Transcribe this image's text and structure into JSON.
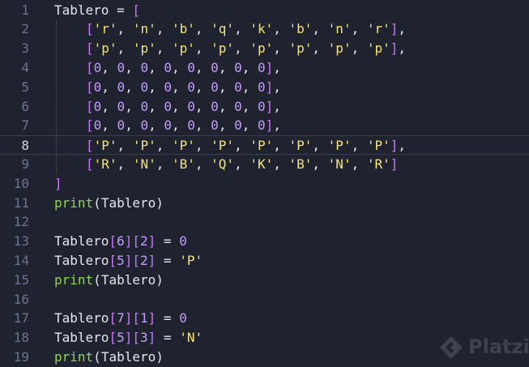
{
  "editor": {
    "colors": {
      "background": "#1f2330",
      "line_number": "#6b7393",
      "identifier": "#e6e6ea",
      "bracket": "#c678f7",
      "string": "#f5e37a",
      "number": "#c39df9",
      "builtin_call": "#8ed650"
    },
    "current_line": 8,
    "lines": [
      {
        "num": "1",
        "tokens": [
          [
            "ident",
            "Tablero"
          ],
          [
            "op",
            " = "
          ],
          [
            "brack",
            "["
          ]
        ]
      },
      {
        "num": "2",
        "indent": true,
        "tokens": [
          [
            "brack",
            "["
          ],
          [
            "str",
            "'r'"
          ],
          [
            "op",
            ", "
          ],
          [
            "str",
            "'n'"
          ],
          [
            "op",
            ", "
          ],
          [
            "str",
            "'b'"
          ],
          [
            "op",
            ", "
          ],
          [
            "str",
            "'q'"
          ],
          [
            "op",
            ", "
          ],
          [
            "str",
            "'k'"
          ],
          [
            "op",
            ", "
          ],
          [
            "str",
            "'b'"
          ],
          [
            "op",
            ", "
          ],
          [
            "str",
            "'n'"
          ],
          [
            "op",
            ", "
          ],
          [
            "str",
            "'r'"
          ],
          [
            "brack",
            "]"
          ],
          [
            "op",
            ","
          ]
        ]
      },
      {
        "num": "3",
        "indent": true,
        "tokens": [
          [
            "brack",
            "["
          ],
          [
            "str",
            "'p'"
          ],
          [
            "op",
            ", "
          ],
          [
            "str",
            "'p'"
          ],
          [
            "op",
            ", "
          ],
          [
            "str",
            "'p'"
          ],
          [
            "op",
            ", "
          ],
          [
            "str",
            "'p'"
          ],
          [
            "op",
            ", "
          ],
          [
            "str",
            "'p'"
          ],
          [
            "op",
            ", "
          ],
          [
            "str",
            "'p'"
          ],
          [
            "op",
            ", "
          ],
          [
            "str",
            "'p'"
          ],
          [
            "op",
            ", "
          ],
          [
            "str",
            "'p'"
          ],
          [
            "brack",
            "]"
          ],
          [
            "op",
            ","
          ]
        ]
      },
      {
        "num": "4",
        "indent": true,
        "tokens": [
          [
            "brack",
            "["
          ],
          [
            "num",
            "0"
          ],
          [
            "op",
            ", "
          ],
          [
            "num",
            "0"
          ],
          [
            "op",
            ", "
          ],
          [
            "num",
            "0"
          ],
          [
            "op",
            ", "
          ],
          [
            "num",
            "0"
          ],
          [
            "op",
            ", "
          ],
          [
            "num",
            "0"
          ],
          [
            "op",
            ", "
          ],
          [
            "num",
            "0"
          ],
          [
            "op",
            ", "
          ],
          [
            "num",
            "0"
          ],
          [
            "op",
            ", "
          ],
          [
            "num",
            "0"
          ],
          [
            "brack",
            "]"
          ],
          [
            "op",
            ","
          ]
        ]
      },
      {
        "num": "5",
        "indent": true,
        "tokens": [
          [
            "brack",
            "["
          ],
          [
            "num",
            "0"
          ],
          [
            "op",
            ", "
          ],
          [
            "num",
            "0"
          ],
          [
            "op",
            ", "
          ],
          [
            "num",
            "0"
          ],
          [
            "op",
            ", "
          ],
          [
            "num",
            "0"
          ],
          [
            "op",
            ", "
          ],
          [
            "num",
            "0"
          ],
          [
            "op",
            ", "
          ],
          [
            "num",
            "0"
          ],
          [
            "op",
            ", "
          ],
          [
            "num",
            "0"
          ],
          [
            "op",
            ", "
          ],
          [
            "num",
            "0"
          ],
          [
            "brack",
            "]"
          ],
          [
            "op",
            ","
          ]
        ]
      },
      {
        "num": "6",
        "indent": true,
        "tokens": [
          [
            "brack",
            "["
          ],
          [
            "num",
            "0"
          ],
          [
            "op",
            ", "
          ],
          [
            "num",
            "0"
          ],
          [
            "op",
            ", "
          ],
          [
            "num",
            "0"
          ],
          [
            "op",
            ", "
          ],
          [
            "num",
            "0"
          ],
          [
            "op",
            ", "
          ],
          [
            "num",
            "0"
          ],
          [
            "op",
            ", "
          ],
          [
            "num",
            "0"
          ],
          [
            "op",
            ", "
          ],
          [
            "num",
            "0"
          ],
          [
            "op",
            ", "
          ],
          [
            "num",
            "0"
          ],
          [
            "brack",
            "]"
          ],
          [
            "op",
            ","
          ]
        ]
      },
      {
        "num": "7",
        "indent": true,
        "tokens": [
          [
            "brack",
            "["
          ],
          [
            "num",
            "0"
          ],
          [
            "op",
            ", "
          ],
          [
            "num",
            "0"
          ],
          [
            "op",
            ", "
          ],
          [
            "num",
            "0"
          ],
          [
            "op",
            ", "
          ],
          [
            "num",
            "0"
          ],
          [
            "op",
            ", "
          ],
          [
            "num",
            "0"
          ],
          [
            "op",
            ", "
          ],
          [
            "num",
            "0"
          ],
          [
            "op",
            ", "
          ],
          [
            "num",
            "0"
          ],
          [
            "op",
            ", "
          ],
          [
            "num",
            "0"
          ],
          [
            "brack",
            "]"
          ],
          [
            "op",
            ","
          ]
        ]
      },
      {
        "num": "8",
        "indent": true,
        "tokens": [
          [
            "brack",
            "["
          ],
          [
            "str",
            "'P'"
          ],
          [
            "op",
            ", "
          ],
          [
            "str",
            "'P'"
          ],
          [
            "op",
            ", "
          ],
          [
            "str",
            "'P'"
          ],
          [
            "op",
            ", "
          ],
          [
            "str",
            "'P'"
          ],
          [
            "op",
            ", "
          ],
          [
            "str",
            "'P'"
          ],
          [
            "op",
            ", "
          ],
          [
            "str",
            "'P'"
          ],
          [
            "op",
            ", "
          ],
          [
            "str",
            "'P'"
          ],
          [
            "op",
            ", "
          ],
          [
            "str",
            "'P'"
          ],
          [
            "brack",
            "]"
          ],
          [
            "op",
            ","
          ]
        ]
      },
      {
        "num": "9",
        "indent": true,
        "tokens": [
          [
            "brack",
            "["
          ],
          [
            "str",
            "'R'"
          ],
          [
            "op",
            ", "
          ],
          [
            "str",
            "'N'"
          ],
          [
            "op",
            ", "
          ],
          [
            "str",
            "'B'"
          ],
          [
            "op",
            ", "
          ],
          [
            "str",
            "'Q'"
          ],
          [
            "op",
            ", "
          ],
          [
            "str",
            "'K'"
          ],
          [
            "op",
            ", "
          ],
          [
            "str",
            "'B'"
          ],
          [
            "op",
            ", "
          ],
          [
            "str",
            "'N'"
          ],
          [
            "op",
            ", "
          ],
          [
            "str",
            "'R'"
          ],
          [
            "brack",
            "]"
          ]
        ]
      },
      {
        "num": "10",
        "tokens": [
          [
            "brack",
            "]"
          ]
        ]
      },
      {
        "num": "11",
        "tokens": [
          [
            "call",
            "print"
          ],
          [
            "paren",
            "("
          ],
          [
            "ident",
            "Tablero"
          ],
          [
            "paren",
            ")"
          ]
        ]
      },
      {
        "num": "12",
        "tokens": []
      },
      {
        "num": "13",
        "tokens": [
          [
            "ident",
            "Tablero"
          ],
          [
            "brack",
            "["
          ],
          [
            "num",
            "6"
          ],
          [
            "brack",
            "]"
          ],
          [
            "brack",
            "["
          ],
          [
            "num",
            "2"
          ],
          [
            "brack",
            "]"
          ],
          [
            "op",
            " = "
          ],
          [
            "num",
            "0"
          ]
        ]
      },
      {
        "num": "14",
        "tokens": [
          [
            "ident",
            "Tablero"
          ],
          [
            "brack",
            "["
          ],
          [
            "num",
            "5"
          ],
          [
            "brack",
            "]"
          ],
          [
            "brack",
            "["
          ],
          [
            "num",
            "2"
          ],
          [
            "brack",
            "]"
          ],
          [
            "op",
            " = "
          ],
          [
            "str",
            "'P'"
          ]
        ]
      },
      {
        "num": "15",
        "tokens": [
          [
            "call",
            "print"
          ],
          [
            "paren",
            "("
          ],
          [
            "ident",
            "Tablero"
          ],
          [
            "paren",
            ")"
          ]
        ]
      },
      {
        "num": "16",
        "tokens": []
      },
      {
        "num": "17",
        "tokens": [
          [
            "ident",
            "Tablero"
          ],
          [
            "brack",
            "["
          ],
          [
            "num",
            "7"
          ],
          [
            "brack",
            "]"
          ],
          [
            "brack",
            "["
          ],
          [
            "num",
            "1"
          ],
          [
            "brack",
            "]"
          ],
          [
            "op",
            " = "
          ],
          [
            "num",
            "0"
          ]
        ]
      },
      {
        "num": "18",
        "tokens": [
          [
            "ident",
            "Tablero"
          ],
          [
            "brack",
            "["
          ],
          [
            "num",
            "5"
          ],
          [
            "brack",
            "]"
          ],
          [
            "brack",
            "["
          ],
          [
            "num",
            "3"
          ],
          [
            "brack",
            "]"
          ],
          [
            "op",
            " = "
          ],
          [
            "str",
            "'N'"
          ]
        ]
      },
      {
        "num": "19",
        "tokens": [
          [
            "call",
            "print"
          ],
          [
            "paren",
            "("
          ],
          [
            "ident",
            "Tablero"
          ],
          [
            "paren",
            ")"
          ]
        ]
      }
    ]
  },
  "watermark": {
    "text": "Platzi",
    "icon": "platzi-logo-icon"
  }
}
